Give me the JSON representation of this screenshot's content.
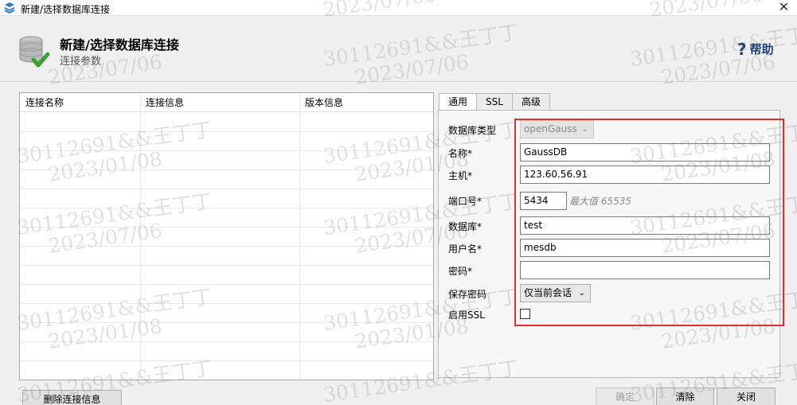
{
  "window": {
    "title": "新建/选择数据库连接",
    "close_glyph": "✕"
  },
  "header": {
    "title": "新建/选择数据库连接",
    "subtitle": "连接参数",
    "help_label": "帮助",
    "help_glyph": "?"
  },
  "connections_table": {
    "columns": [
      "连接名称",
      "连接信息",
      "版本信息"
    ],
    "rows": []
  },
  "tabs": [
    {
      "label": "通用",
      "active": true
    },
    {
      "label": "SSL",
      "active": false
    },
    {
      "label": "高级",
      "active": false
    }
  ],
  "form": {
    "db_type": {
      "label": "数据库类型",
      "value": "openGauss"
    },
    "name": {
      "label": "名称*",
      "value": "GaussDB"
    },
    "host": {
      "label": "主机*",
      "value": "123.60.56.91"
    },
    "port": {
      "label": "端口号*",
      "value": "5434",
      "hint": "最大值 65535"
    },
    "database": {
      "label": "数据库*",
      "value": "test"
    },
    "username": {
      "label": "用户名*",
      "value": "mesdb"
    },
    "password": {
      "label": "密码*",
      "value": ""
    },
    "save_password": {
      "label": "保存密码",
      "value": "仅当前会话"
    },
    "enable_ssl": {
      "label": "启用SSL",
      "checked": false
    }
  },
  "buttons": {
    "delete_label": "删除连接信息",
    "ok_label": "确定",
    "clear_label": "清除",
    "close_label": "关闭"
  },
  "watermark": {
    "line1": "30112691&&王丁丁",
    "date_a": "2023/07/06",
    "date_b": "2023/01/08"
  },
  "colors": {
    "highlight_border": "#e03030",
    "help_text": "#1a3f7a"
  },
  "icons": {
    "app": "database-stack-icon",
    "header": "database-check-icon",
    "dropdown": "chevron-down-icon"
  }
}
